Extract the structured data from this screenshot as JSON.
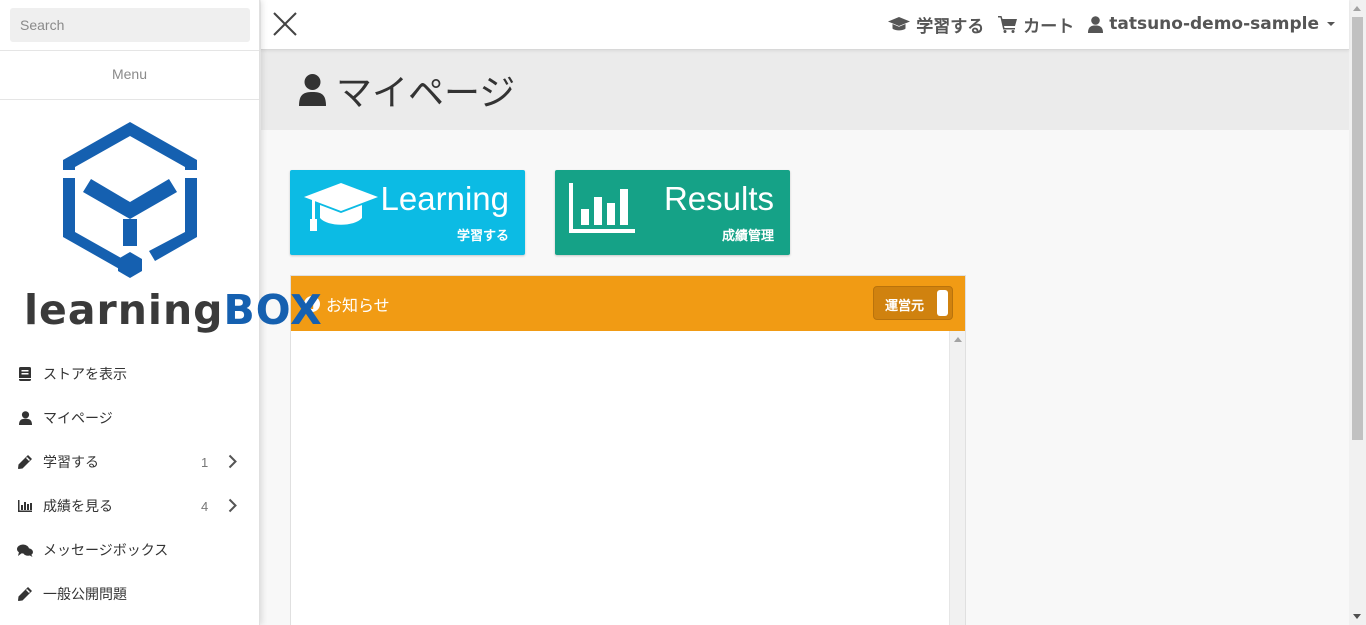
{
  "sidebar": {
    "search_placeholder": "Search",
    "menu_label": "Menu",
    "logo": {
      "text_part1": "learning",
      "text_part2": "BOX",
      "color_dark": "#3a3a3a",
      "color_brand": "#1560b0"
    },
    "items": [
      {
        "label": "ストアを表示",
        "icon": "book-icon"
      },
      {
        "label": "マイページ",
        "icon": "user-icon"
      },
      {
        "label": "学習する",
        "icon": "pencil-icon",
        "count": "1"
      },
      {
        "label": "成績を見る",
        "icon": "bar-chart-icon",
        "count": "4"
      },
      {
        "label": "メッセージボックス",
        "icon": "comments-icon"
      },
      {
        "label": "一般公開問題",
        "icon": "pencil-icon"
      }
    ]
  },
  "header": {
    "learn_label": "学習する",
    "cart_label": "カート",
    "user_label": "tatsuno-demo-sample"
  },
  "page": {
    "title": "マイページ"
  },
  "cards": {
    "learning": {
      "title": "Learning",
      "subtitle": "学習する",
      "color": "#0cbbe4"
    },
    "results": {
      "title": "Results",
      "subtitle": "成績管理",
      "color": "#15a287"
    }
  },
  "notice": {
    "title": "お知らせ",
    "toggle_label": "運営元",
    "color": "#f19b14"
  }
}
